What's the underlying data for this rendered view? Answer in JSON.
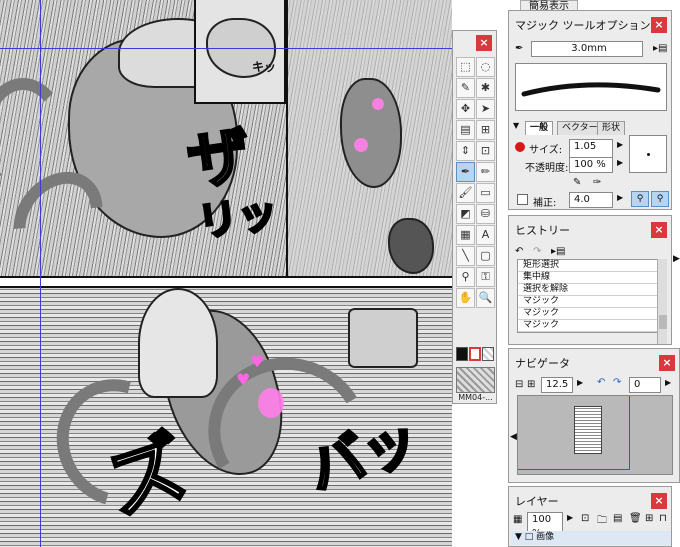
{
  "top_label": "簡易表示",
  "tool_palette": {
    "close_label": "×",
    "thumbnail_label": "MM04-...",
    "tools": [
      {
        "icon": "marquee-rect-icon",
        "glyph": "⬚"
      },
      {
        "icon": "lasso-icon",
        "glyph": "◌"
      },
      {
        "icon": "select-pen-icon",
        "glyph": "✎"
      },
      {
        "icon": "wand-icon",
        "glyph": "✱"
      },
      {
        "icon": "move-icon",
        "glyph": "✥"
      },
      {
        "icon": "arrow-icon",
        "glyph": "➤"
      },
      {
        "icon": "frame-icon",
        "glyph": "▤"
      },
      {
        "icon": "ruler-icon",
        "glyph": "⊞"
      },
      {
        "icon": "layer-move-icon",
        "glyph": "⇕"
      },
      {
        "icon": "zoom-frame-icon",
        "glyph": "⊡"
      },
      {
        "icon": "magic-pen-icon",
        "glyph": "✒"
      },
      {
        "icon": "pencil-icon",
        "glyph": "✏"
      },
      {
        "icon": "brush-icon",
        "glyph": "🖌"
      },
      {
        "icon": "eraser-icon",
        "glyph": "▭"
      },
      {
        "icon": "fill-icon",
        "glyph": "◩"
      },
      {
        "icon": "bucket-icon",
        "glyph": "⛁"
      },
      {
        "icon": "gradient-icon",
        "glyph": "▦"
      },
      {
        "icon": "text-icon",
        "glyph": "A"
      },
      {
        "icon": "line-icon",
        "glyph": "╲"
      },
      {
        "icon": "rect-icon",
        "glyph": "▢"
      },
      {
        "icon": "eyedropper-icon",
        "glyph": "⚲"
      },
      {
        "icon": "stamp-icon",
        "glyph": "⚿"
      },
      {
        "icon": "hand-icon",
        "glyph": "✋"
      },
      {
        "icon": "zoom-icon",
        "glyph": "🔍"
      }
    ]
  },
  "magic_tool_options": {
    "title": "マジック ツールオプション",
    "close_label": "×",
    "preset_size": "3.0mm",
    "tabs": [
      "一般",
      "ベクター",
      "形状"
    ],
    "size_label": "サイズ:",
    "size_value": "1.05 mm",
    "opacity_label": "不透明度:",
    "opacity_value": "100 %",
    "correction_label": "補正:",
    "correction_value": "4.0"
  },
  "history": {
    "title": "ヒストリー",
    "close_label": "×",
    "items": [
      "矩形選択",
      "集中線",
      "選択を解除",
      "マジック",
      "マジック",
      "マジック"
    ]
  },
  "navigator": {
    "title": "ナビゲータ",
    "close_label": "×",
    "zoom_value": "12.5",
    "rotation_value": "0"
  },
  "layers": {
    "title": "レイヤー",
    "close_label": "×",
    "opacity_value": "100 %",
    "first_layer": "画像"
  },
  "canvas": {
    "sfx": [
      "ザ",
      "リッ",
      "ズ",
      "バッ"
    ],
    "small_sfx": "キッ"
  }
}
